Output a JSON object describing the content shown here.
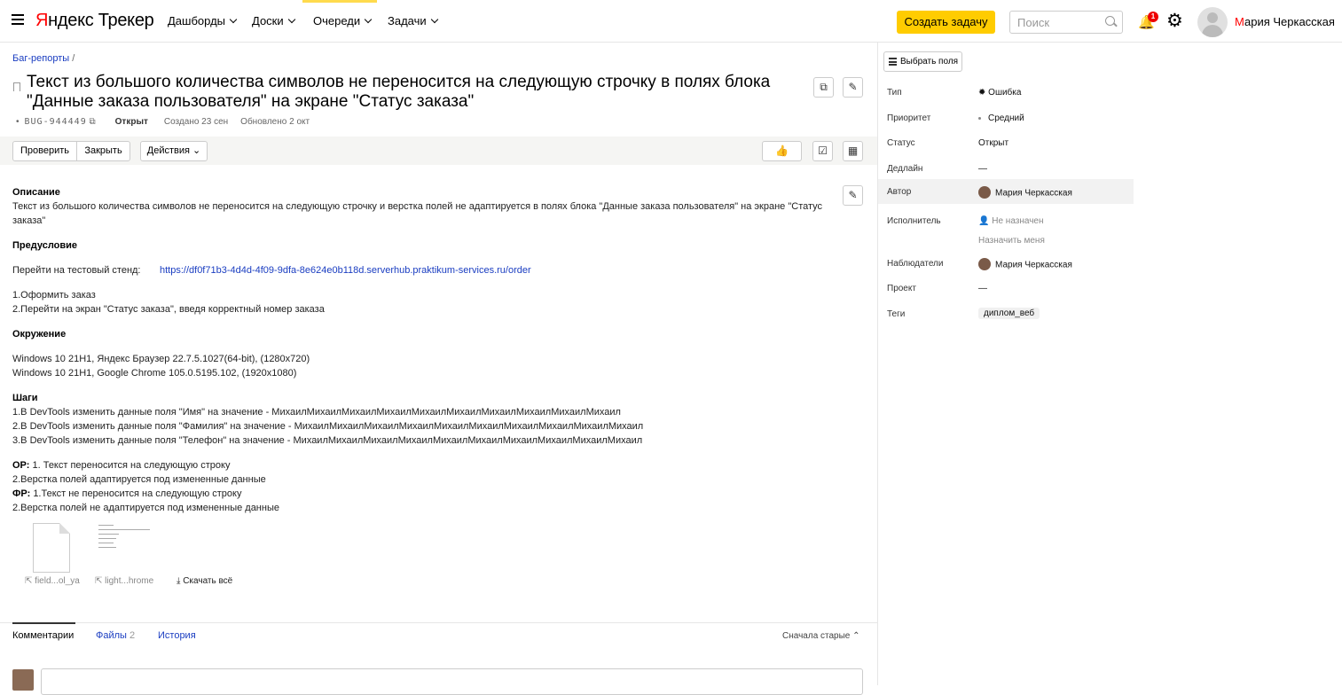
{
  "header": {
    "logo_ya": "Я",
    "logo_rest": "ндекс Трекер",
    "nav": [
      "Дашборды",
      "Доски",
      "Очереди",
      "Задачи"
    ],
    "create_label": "Создать задачу",
    "search_placeholder": "Поиск",
    "notification_count": "1",
    "user_first_letter": "М",
    "user_name_rest": "ария Черкасская",
    "accent_color": "#ffcc00"
  },
  "issue": {
    "breadcrumb": "Баг-репорты",
    "breadcrumb_sep": "/",
    "title": "Текст из большого количества символов не переносится на следующую строчку в полях блока \"Данные заказа пользователя\" на экране \"Статус заказа\"",
    "key": "BUG-944449",
    "status": "Открыт",
    "created": "Создано 23 сен",
    "updated": "Обновлено 2 окт",
    "actions": {
      "check": "Проверить",
      "close": "Закрыть",
      "more": "Действия"
    }
  },
  "description": {
    "h_desc": "Описание",
    "desc": "Текст из большого количества символов не переносится на следующую строчку и верстка полей не адаптируется в полях блока \"Данные заказа пользователя\" на экране \"Статус заказа\"",
    "h_pre": "Предусловие",
    "stand_label": "Перейти на тестовый стенд:",
    "stand_url": "https://df0f71b3-4d4d-4f09-9dfa-8e624e0b118d.serverhub.praktikum-services.ru/order",
    "pre1": "1.Оформить заказ",
    "pre2": "2.Перейти на экран \"Статус заказа\", введя корректный номер заказа",
    "h_env": "Окружение",
    "env1": "Windows 10 21H1, Яндекс Браузер 22.7.5.1027(64-bit), (1280x720)",
    "env2": "Windows 10 21H1, Google Chrome 105.0.5195.102, (1920x1080)",
    "h_steps": "Шаги",
    "step1": "1.В DevTools изменить данные поля \"Имя\" на значение - МихаилМихаилМихаилМихаилМихаилМихаилМихаилМихаилМихаилМихаил",
    "step2": "2.В DevTools изменить данные поля \"Фамилия\" на значение - МихаилМихаилМихаилМихаилМихаилМихаилМихаилМихаилМихаилМихаил",
    "step3": "3.В DevTools изменить данные поля \"Телефон\" на значение - МихаилМихаилМихаилМихаилМихаилМихаилМихаилМихаилМихаилМихаил",
    "or_label": "ОР:",
    "or1": "1. Текст переносится на следующую строку",
    "or2": "2.Верстка полей адаптируется под измененные данные",
    "fr_label": "ФР:",
    "fr1": "1.Текст не переносится на следующую строку",
    "fr2": "2.Верстка полей не адаптируется под измененные данные"
  },
  "attachments": {
    "file1": "field...ol_ya",
    "file2": "light...hrome",
    "download_all": "Скачать всё"
  },
  "tabs": {
    "comments": "Комментарии",
    "files": "Файлы",
    "files_count": "2",
    "history": "История",
    "sort": "Сначала старые"
  },
  "sidebar": {
    "choose_fields": "Выбрать поля",
    "fields": [
      {
        "label": "Тип",
        "value": "Ошибка"
      },
      {
        "label": "Приоритет",
        "value": "Средний"
      },
      {
        "label": "Статус",
        "value": "Открыт"
      },
      {
        "label": "Дедлайн",
        "value": "—"
      },
      {
        "label": "Автор",
        "value": "Мария Черкасская"
      },
      {
        "label": "Исполнитель",
        "value": "Не назначен"
      },
      {
        "label": "Наблюдатели",
        "value": "Мария Черкасская"
      },
      {
        "label": "Проект",
        "value": "—"
      },
      {
        "label": "Теги",
        "value": "диплом_веб"
      }
    ],
    "assign_me": "Назначить меня"
  }
}
